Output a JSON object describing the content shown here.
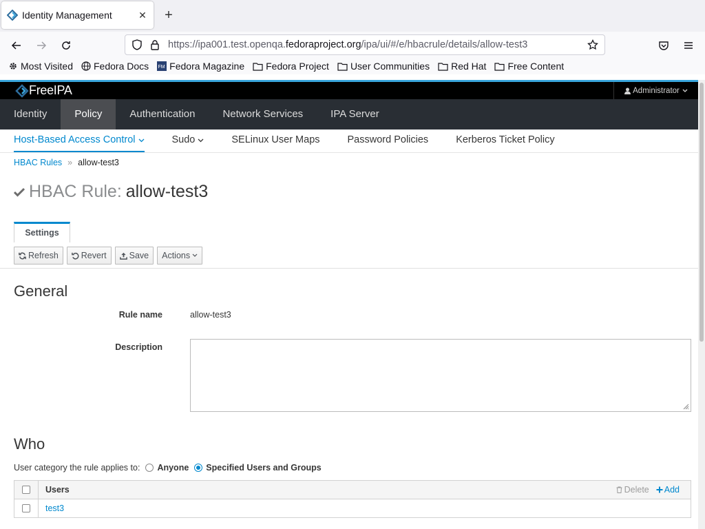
{
  "browser": {
    "tab_title": "Identity Management",
    "url_prefix": "https://ipa001.test.openqa.",
    "url_domain": "fedoraproject.org",
    "url_path": "/ipa/ui/#/e/hbacrule/details/allow-test3",
    "bookmarks": [
      {
        "label": "Most Visited",
        "icon": "gear-icon"
      },
      {
        "label": "Fedora Docs",
        "icon": "globe-icon"
      },
      {
        "label": "Fedora Magazine",
        "icon": "fm-icon"
      },
      {
        "label": "Fedora Project",
        "icon": "folder-icon"
      },
      {
        "label": "User Communities",
        "icon": "folder-icon"
      },
      {
        "label": "Red Hat",
        "icon": "folder-icon"
      },
      {
        "label": "Free Content",
        "icon": "folder-icon"
      }
    ]
  },
  "app": {
    "logo": "FreeIPA",
    "user": "Administrator",
    "nav": [
      "Identity",
      "Policy",
      "Authentication",
      "Network Services",
      "IPA Server"
    ],
    "subnav": [
      "Host-Based Access Control",
      "Sudo",
      "SELinux User Maps",
      "Password Policies",
      "Kerberos Ticket Policy"
    ]
  },
  "page": {
    "breadcrumb_link": "HBAC Rules",
    "breadcrumb_sep": "»",
    "breadcrumb_current": "allow-test3",
    "title_type": "HBAC Rule:",
    "title_name": "allow-test3",
    "tab_settings": "Settings",
    "toolbar": {
      "refresh": "Refresh",
      "revert": "Revert",
      "save": "Save",
      "actions": "Actions"
    },
    "general": {
      "title": "General",
      "rule_name_label": "Rule name",
      "rule_name_value": "allow-test3",
      "description_label": "Description",
      "description_value": ""
    },
    "who": {
      "title": "Who",
      "category_label": "User category the rule applies to:",
      "opt_anyone": "Anyone",
      "opt_specified": "Specified Users and Groups",
      "selected": "Specified Users and Groups",
      "table_header": "Users",
      "delete_label": "Delete",
      "add_label": "Add",
      "rows": [
        "test3"
      ]
    }
  },
  "colors": {
    "accent": "#0088ce",
    "nav_bg": "#292e34",
    "nav_active": "#4b4d51",
    "top_accent": "#39a5dc"
  }
}
